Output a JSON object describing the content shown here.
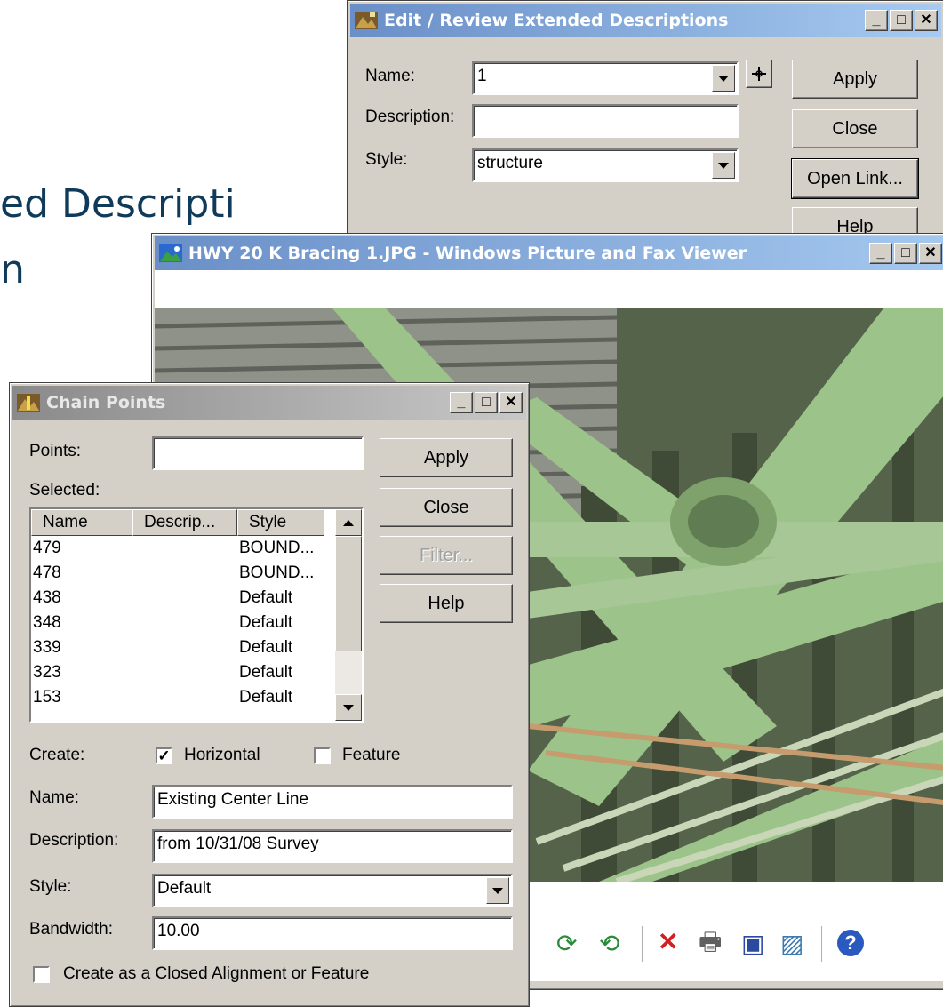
{
  "slide": {
    "line1": "ed Descripti",
    "line2": "n"
  },
  "edit_window": {
    "title": "Edit / Review Extended Descriptions",
    "name_label": "Name:",
    "name_value": "1",
    "description_label": "Description:",
    "description_value": "",
    "style_label": "Style:",
    "style_value": "structure",
    "apply": "Apply",
    "close": "Close",
    "open_link": "Open Link...",
    "help": "Help"
  },
  "viewer_window": {
    "title": "HWY 20 K Bracing 1.JPG - Windows Picture and Fax Viewer"
  },
  "chain_window": {
    "title": "Chain Points",
    "points_label": "Points:",
    "points_value": "",
    "selected_label": "Selected:",
    "columns": [
      "Name",
      "Descrip...",
      "Style"
    ],
    "rows": [
      [
        "479",
        "",
        "BOUND..."
      ],
      [
        "478",
        "",
        "BOUND..."
      ],
      [
        "438",
        "",
        "Default"
      ],
      [
        "348",
        "",
        "Default"
      ],
      [
        "339",
        "",
        "Default"
      ],
      [
        "323",
        "",
        "Default"
      ],
      [
        "153",
        "",
        "Default"
      ]
    ],
    "apply": "Apply",
    "close": "Close",
    "filter": "Filter...",
    "help": "Help",
    "create_label": "Create:",
    "horizontal_label": "Horizontal",
    "horizontal_checked": true,
    "feature_label": "Feature",
    "feature_checked": false,
    "name_label": "Name:",
    "name_value": "Existing Center Line",
    "description_label": "Description:",
    "description_value": "from 10/31/08 Survey",
    "style_label": "Style:",
    "style_value": "Default",
    "bandwidth_label": "Bandwidth:",
    "bandwidth_value": "10.00",
    "closed_label": "Create as a Closed Alignment or Feature",
    "closed_checked": false
  },
  "window_controls": {
    "minimize": "_",
    "maximize": "□",
    "close": "✕"
  }
}
